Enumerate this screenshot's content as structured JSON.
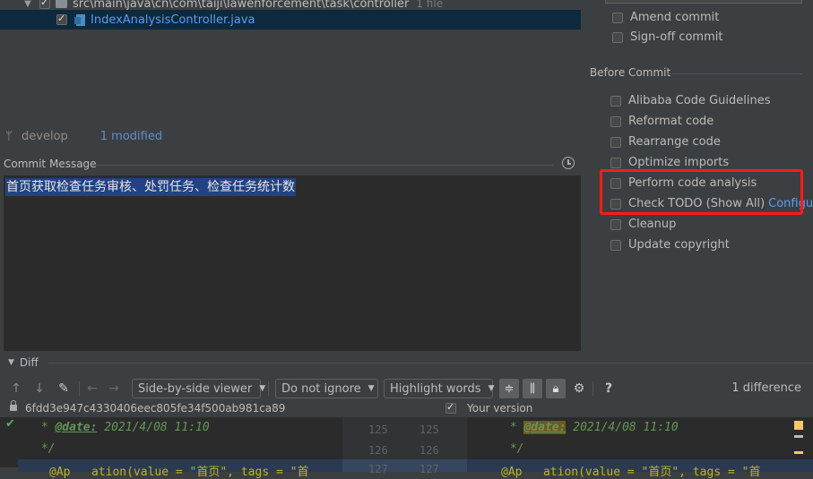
{
  "file_tree": {
    "folder_path": "src\\main\\java\\cn\\com\\taiji\\lawenforcement\\task\\controller",
    "folder_count": "1 file",
    "file_name": "IndexAnalysisController.java"
  },
  "branch": {
    "name": "develop",
    "modified": "1 modified"
  },
  "commit_message": {
    "label": "Commit Message",
    "text": "首页获取检查任务审核、处罚任务、检查任务统计数"
  },
  "commit_options": {
    "amend": "Amend commit",
    "signoff": "Sign-off commit"
  },
  "before_commit": {
    "label": "Before Commit",
    "items": [
      "Alibaba Code Guidelines",
      "Reformat code",
      "Rearrange code",
      "Optimize imports",
      "Perform code analysis",
      "Check TODO (Show All)",
      "Cleanup",
      "Update copyright"
    ],
    "configure": "Configure"
  },
  "diff": {
    "label": "Diff",
    "viewer": "Side-by-side viewer",
    "ignore": "Do not ignore",
    "highlight": "Highlight words",
    "help": "?",
    "count": "1 difference",
    "left_hash": "6fdd3e947c4330406eec805fe34f500ab981ca89",
    "right_title": "Your version",
    "lines": {
      "l1_prefix": " * ",
      "tag": "@date:",
      "l1_value": " 2021/4/08 11:10",
      "l2": " */",
      "l3_left": "@Ap   ation(value = \"首页\", tags = \"首",
      "l3_right": "@Ap   ation(value = \"首页\", tags = \"首",
      "nums": [
        "125",
        "125",
        "126",
        "126",
        "127",
        "127"
      ]
    }
  },
  "colors": {
    "accent": "#589df6",
    "highlight_box": "#ff1a1a",
    "selection": "#214283"
  }
}
